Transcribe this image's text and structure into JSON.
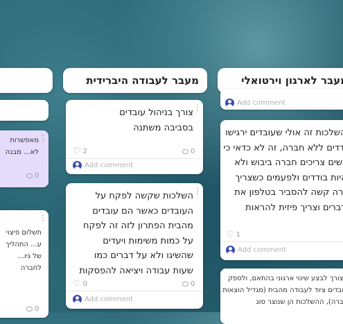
{
  "columns": [
    {
      "title": "מעבר לארגון וירטואלי"
    },
    {
      "title": "מעבר לעבודה היברידית"
    }
  ],
  "cards": {
    "c2_1": {
      "text": "צורך בניהול עובדים בסביבה משתנה",
      "likes": "2",
      "comments": "0",
      "add_comment": "Add comment"
    },
    "c2_2": {
      "text": "השלכות שקשה לפקח על העובדים כאשר הם עובדים מהבית הפתרון לזה זה לפקח על כמות משימות ויעדים שהשיגו ולא על דברים כמו שעות עבודה ויציאה להפסקות",
      "likes": "0",
      "comments": "0",
      "add_comment": "Add comment"
    },
    "c3_top": {
      "add_comment": "Add comment"
    },
    "c3_1": {
      "text": "ההשלכות זה אולי שעובדים ירגישו בודדים ללא חברה, זה לא כדאי כי אנשים צריכים חברה ביבוש ולא להיות בודדים ולפעמים כשצריך עזרה קשה להסביר בטלפון את הדברים וצריך פיזית להראות",
      "likes": "1",
      "add_comment": "Add comment"
    },
    "c3_2": {
      "text": "יש צורך לבצע שינוי ארגוני בהתאם, ולספק לעובדים ציוד לעבודה מהבית (מגדיל הוצאות לחברה), ההשלכות הן שנוצר סוג"
    },
    "c1_1": {
      "text": "מאפשרות לא... מבנה ארגוני...",
      "comments": "0"
    },
    "c1_2": {
      "text": "תשלום פיצוי ע... התהליך של גיו... לחברה והכשר... לחברה",
      "comments": "0"
    }
  }
}
